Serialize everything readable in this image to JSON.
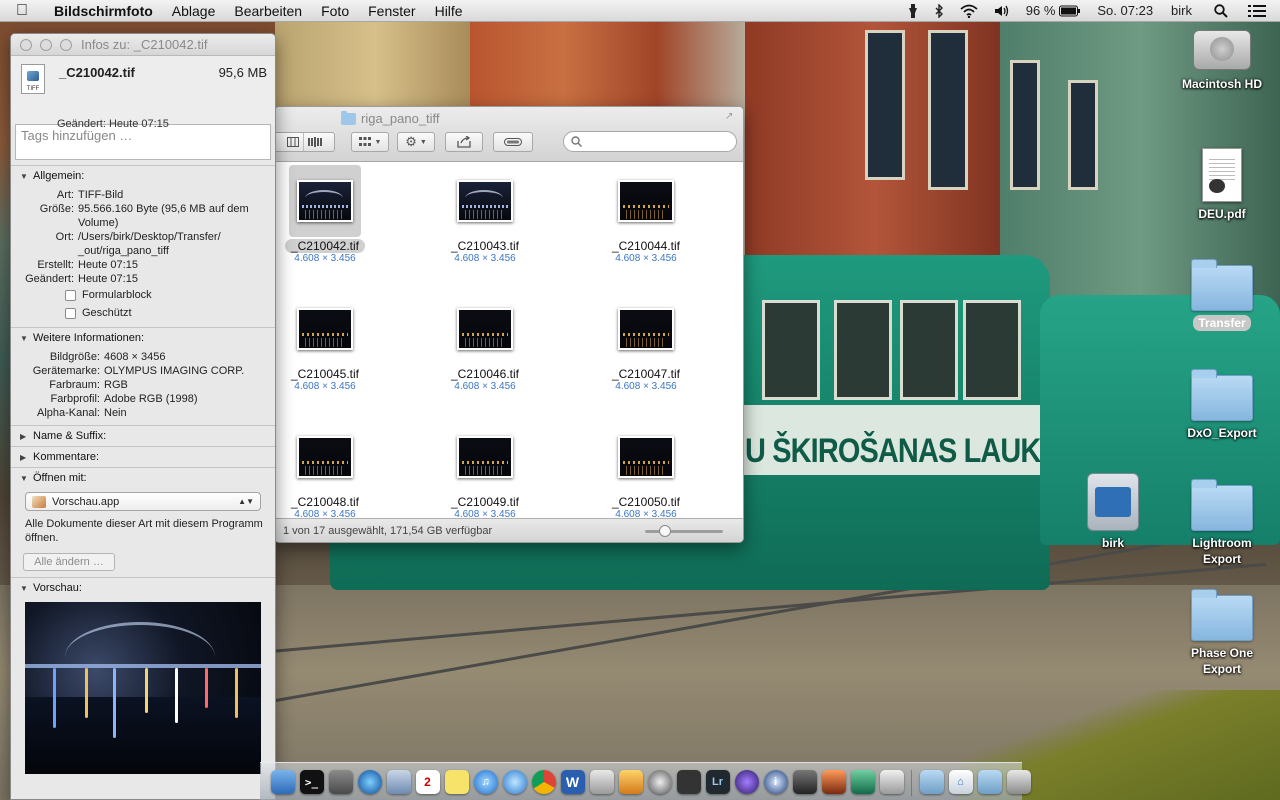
{
  "menubar": {
    "app": "Bildschirmfoto",
    "items": [
      "Ablage",
      "Bearbeiten",
      "Foto",
      "Fenster",
      "Hilfe"
    ],
    "battery": "96 %",
    "clock": "So. 07:23",
    "user": "birk"
  },
  "info_window": {
    "title": "Infos zu: _C210042.tif",
    "file_name": "_C210042.tif",
    "file_size": "95,6 MB",
    "icon_badge": "TIFF",
    "modified_header": "Geändert: Heute 07:15",
    "tags_placeholder": "Tags hinzufügen …",
    "general": {
      "heading": "Allgemein:",
      "rows": [
        {
          "k": "Art:",
          "v": "TIFF-Bild"
        },
        {
          "k": "Größe:",
          "v": "95.566.160 Byte (95,6 MB auf dem Volume)"
        },
        {
          "k": "Ort:",
          "v": "/Users/birk/Desktop/Transfer/ _out/riga_pano_tiff"
        },
        {
          "k": "Erstellt:",
          "v": "Heute 07:15"
        },
        {
          "k": "Geändert:",
          "v": "Heute 07:15"
        }
      ],
      "checkbox_stationery": "Formularblock",
      "checkbox_locked": "Geschützt"
    },
    "more_info": {
      "heading": "Weitere Informationen:",
      "rows": [
        {
          "k": "Bildgröße:",
          "v": "4608 × 3456"
        },
        {
          "k": "Gerätemarke:",
          "v": "OLYMPUS IMAGING CORP."
        },
        {
          "k": "Farbraum:",
          "v": "RGB"
        },
        {
          "k": "Farbprofil:",
          "v": "Adobe RGB (1998)"
        },
        {
          "k": "Alpha-Kanal:",
          "v": "Nein"
        }
      ]
    },
    "name_ext": "Name & Suffix:",
    "comments": "Kommentare:",
    "open_with": {
      "heading": "Öffnen mit:",
      "app": "Vorschau.app",
      "note": "Alle Dokumente dieser Art mit diesem Programm öffnen.",
      "button": "Alle ändern …"
    },
    "preview_heading": "Vorschau:"
  },
  "finder": {
    "title": "riga_pano_tiff",
    "status": "1 von 17 ausgewählt, 171,54 GB verfügbar",
    "files": [
      {
        "name": "_C210042.tif",
        "dims": "4.608 × 3.456"
      },
      {
        "name": "_C210043.tif",
        "dims": "4.608 × 3.456"
      },
      {
        "name": "_C210044.tif",
        "dims": "4.608 × 3.456"
      },
      {
        "name": "_C210045.tif",
        "dims": "4.608 × 3.456"
      },
      {
        "name": "_C210046.tif",
        "dims": "4.608 × 3.456"
      },
      {
        "name": "_C210047.tif",
        "dims": "4.608 × 3.456"
      },
      {
        "name": "_C210048.tif",
        "dims": "4.608 × 3.456"
      },
      {
        "name": "_C210049.tif",
        "dims": "4.608 × 3.456"
      },
      {
        "name": "_C210050.tif",
        "dims": "4.608 × 3.456"
      }
    ]
  },
  "desktop": {
    "icons": {
      "hd": "Macintosh HD",
      "pdf": "DEU.pdf",
      "transfer": "Transfer",
      "dxo": "DxO_Export",
      "lightroom": "Lightroom Export",
      "phaseone": "Phase One Export",
      "home": "birk"
    },
    "tram_text": "U ŠKIROŠANAS LAUKUMS"
  },
  "dock": {
    "calendar_day": "2",
    "lightroom": "Lr",
    "word": "W"
  },
  "colors": {
    "accent": "#3b76c2",
    "selection": "#d0d0d0"
  }
}
